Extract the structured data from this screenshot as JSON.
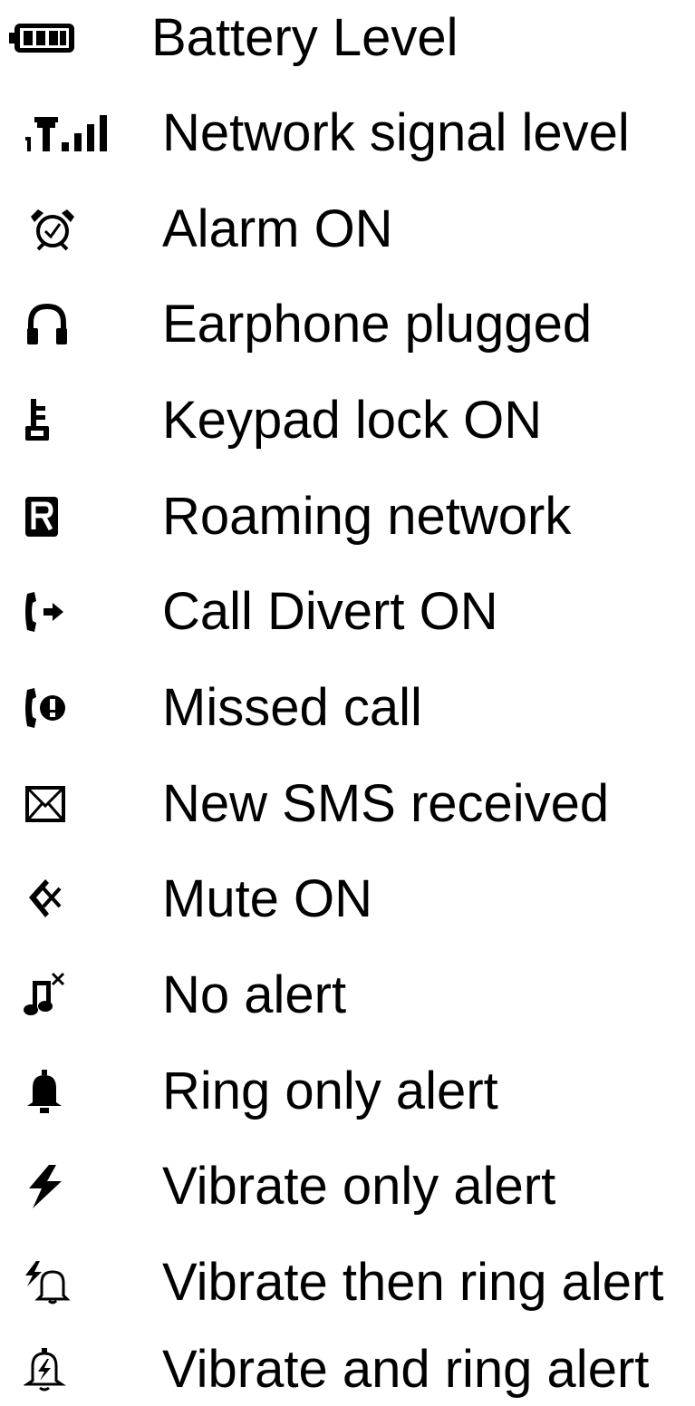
{
  "legend": {
    "items": [
      {
        "icon": "battery-level-icon",
        "label": "Battery Level"
      },
      {
        "icon": "network-signal-icon",
        "label": "Network signal level"
      },
      {
        "icon": "alarm-clock-icon",
        "label": "Alarm ON"
      },
      {
        "icon": "earphone-icon",
        "label": "Earphone plugged"
      },
      {
        "icon": "key-lock-icon",
        "label": "Keypad lock ON"
      },
      {
        "icon": "roaming-r-icon",
        "label": "Roaming network"
      },
      {
        "icon": "call-divert-icon",
        "label": "Call Divert ON"
      },
      {
        "icon": "missed-call-icon",
        "label": "Missed call"
      },
      {
        "icon": "envelope-icon",
        "label": "New SMS received"
      },
      {
        "icon": "mute-speaker-icon",
        "label": "Mute ON"
      },
      {
        "icon": "no-alert-music-icon",
        "label": "No alert"
      },
      {
        "icon": "bell-icon",
        "label": "Ring only alert"
      },
      {
        "icon": "vibrate-bolt-icon",
        "label": "Vibrate only alert"
      },
      {
        "icon": "vibrate-then-ring-icon",
        "label": "Vibrate then ring alert"
      },
      {
        "icon": "vibrate-and-ring-icon",
        "label": "Vibrate and ring alert"
      }
    ]
  },
  "colors": {
    "text": "#000000",
    "icon": "#000000",
    "background": "#ffffff"
  }
}
